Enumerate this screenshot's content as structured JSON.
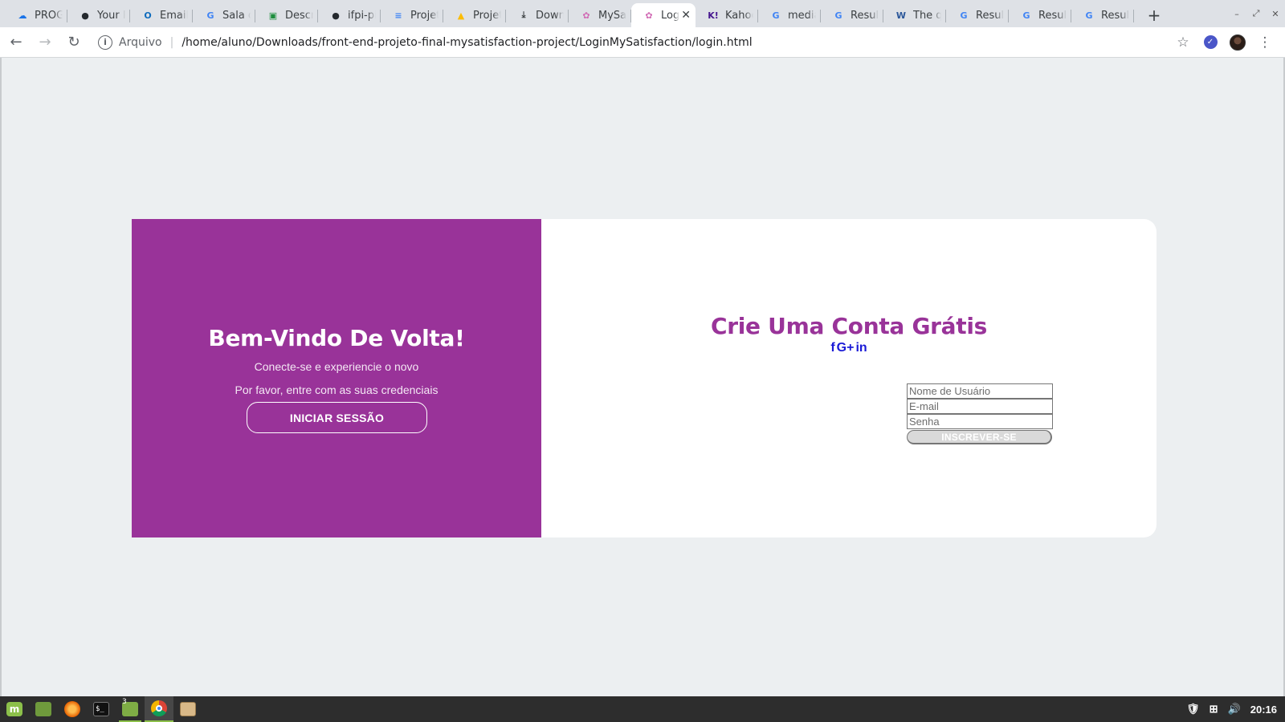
{
  "browser": {
    "tabs": [
      {
        "title": "PROGR",
        "favicon": "onedrive-cloud-icon",
        "color": "#1a73e8"
      },
      {
        "title": "Your R",
        "favicon": "github-icon",
        "color": "#24292e"
      },
      {
        "title": "Email -",
        "favicon": "outlook-icon",
        "color": "#0f6cbd"
      },
      {
        "title": "Sala de",
        "favicon": "google-icon",
        "color": "#4285f4"
      },
      {
        "title": "Descri",
        "favicon": "classroom-icon",
        "color": "#1e8e3e"
      },
      {
        "title": "ifpi-pic",
        "favicon": "github-icon",
        "color": "#24292e"
      },
      {
        "title": "Projeto",
        "favicon": "docs-icon",
        "color": "#4285f4"
      },
      {
        "title": "Projeto",
        "favicon": "drive-icon",
        "color": "#fbbc04"
      },
      {
        "title": "Downl",
        "favicon": "download-icon",
        "color": "#3c4043"
      },
      {
        "title": "MySati",
        "favicon": "mysatisfaction-icon",
        "color": "#d16bb5"
      },
      {
        "title": "Log",
        "favicon": "mysatisfaction-icon",
        "color": "#d16bb5",
        "active": true
      },
      {
        "title": "Kahoo",
        "favicon": "kahoot-icon",
        "color": "#46178f"
      },
      {
        "title": "media",
        "favicon": "google-icon",
        "color": "#4285f4"
      },
      {
        "title": "Result",
        "favicon": "google-icon",
        "color": "#4285f4"
      },
      {
        "title": "The qu",
        "favicon": "word-icon",
        "color": "#2b579a"
      },
      {
        "title": "Result",
        "favicon": "google-icon",
        "color": "#4285f4"
      },
      {
        "title": "Result",
        "favicon": "google-icon",
        "color": "#4285f4"
      },
      {
        "title": "Result",
        "favicon": "google-icon",
        "color": "#4285f4"
      }
    ],
    "omnibox": {
      "scheme_label": "Arquivo",
      "url": "/home/aluno/Downloads/front-end-projeto-final-mysatisfaction-project/LoginMySatisfaction/login.html"
    }
  },
  "page": {
    "accent_color": "#993399",
    "welcome": {
      "title": "Bem-Vindo De Volta!",
      "subtitle1": "Conecte-se e experiencie o novo",
      "subtitle2": "Por favor, entre com as suas credenciais",
      "signin_label": "INICIAR SESSÃO"
    },
    "signup": {
      "title": "Crie Uma Conta Grátis",
      "social": [
        "f",
        "G+",
        "in"
      ],
      "username_placeholder": "Nome de Usuário",
      "email_placeholder": "E-mail",
      "password_placeholder": "Senha",
      "submit_label": "INSCREVER-SE"
    }
  },
  "taskbar": {
    "apps": [
      "mint-menu-icon",
      "show-desktop-icon",
      "firefox-icon",
      "terminal-icon",
      "files-icon",
      "chrome-icon",
      "archive-icon"
    ],
    "files_badge": "3",
    "clock": "20:16"
  }
}
